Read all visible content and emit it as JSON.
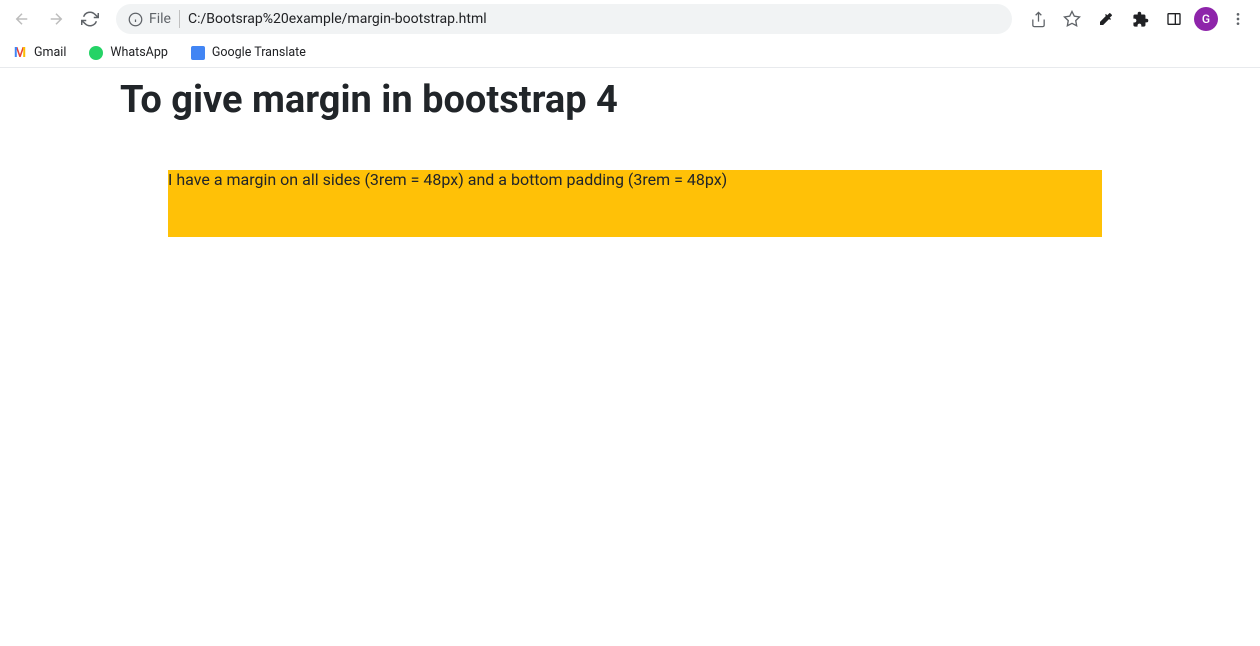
{
  "toolbar": {
    "file_label": "File",
    "url": "C:/Bootsrap%20example/margin-bootstrap.html",
    "avatar_letter": "G"
  },
  "bookmarks": {
    "gmail": "Gmail",
    "whatsapp": "WhatsApp",
    "google_translate": "Google Translate"
  },
  "page": {
    "heading": "To give margin in bootstrap 4",
    "box_text": "I have a margin on all sides (3rem = 48px) and a bottom padding (3rem = 48px)"
  },
  "colors": {
    "warning_bg": "#ffc107",
    "avatar_bg": "#8e24aa"
  }
}
